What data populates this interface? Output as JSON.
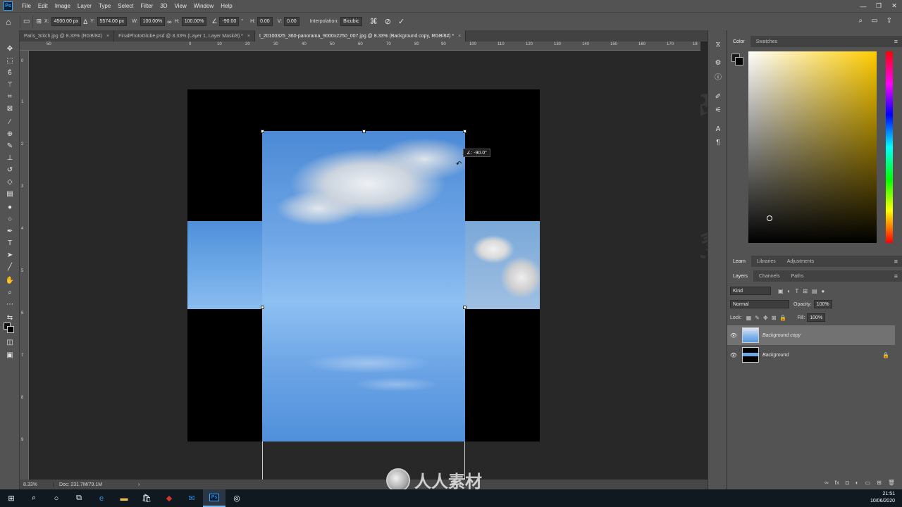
{
  "app": {
    "logo_text": "Ps"
  },
  "menu": [
    "File",
    "Edit",
    "Image",
    "Layer",
    "Type",
    "Select",
    "Filter",
    "3D",
    "View",
    "Window",
    "Help"
  ],
  "window_controls": [
    "—",
    "❐",
    "✕"
  ],
  "options_bar": {
    "x_label": "X:",
    "x_value": "4500.00 px",
    "y_label": "Y:",
    "y_value": "5574.00 px",
    "w_label": "W:",
    "w_value": "100.00%",
    "h_label": "H:",
    "h_value": "100.00%",
    "angle_value": "-90.00",
    "angle_unit": "°",
    "hskew_label": "H:",
    "hskew_value": "0.00",
    "vskew_label": "V:",
    "vskew_value": "0.00",
    "interpolation_label": "Interpolation:",
    "interpolation_value": "Bicubic"
  },
  "tabs": [
    {
      "label": "Paris_Stitch.jpg @ 8.33% (RGB/8#)",
      "close": "×"
    },
    {
      "label": "FinalPhotoGlobe.psd @ 8.33% (Layer 1, Layer Mask/8) *",
      "close": "×"
    },
    {
      "label": "t_20100325_360-panorama_9000x2250_007.jpg @ 8.33% (Background copy, RGB/8#) *",
      "close": "×"
    }
  ],
  "ruler_top_labels": [
    "50",
    "0",
    "10",
    "20",
    "30",
    "40",
    "50",
    "60",
    "70",
    "80",
    "90",
    "100",
    "110",
    "120",
    "130",
    "140",
    "150",
    "160",
    "170",
    "18"
  ],
  "ruler_left_labels": [
    "0",
    "1",
    "2",
    "3",
    "4",
    "5",
    "6",
    "7",
    "8",
    "9"
  ],
  "transform": {
    "angle_tooltip": "∠: -90.0°"
  },
  "color_panel": {
    "tabs": [
      "Color",
      "Swatches"
    ]
  },
  "learn_panel": {
    "tabs": [
      "Learn",
      "Libraries",
      "Adjustments"
    ]
  },
  "layers_panel": {
    "tabs": [
      "Layers",
      "Channels",
      "Paths"
    ],
    "kind_placeholder": "Kind",
    "blend_mode": "Normal",
    "opacity_label": "Opacity:",
    "opacity_value": "100%",
    "lock_label": "Lock:",
    "fill_label": "Fill:",
    "fill_value": "100%",
    "layers": [
      {
        "name": "Background copy",
        "selected": true
      },
      {
        "name": "Background",
        "selected": false,
        "locked": true
      }
    ]
  },
  "status": {
    "zoom": "8.33%",
    "doc": "Doc: 231.7M/79.1M",
    "arrow": "›"
  },
  "taskbar": {
    "time": "21:51",
    "date": "10/06/2020"
  },
  "watermark": {
    "bottom_text": "人人素材",
    "tiles": [
      "RRCG",
      "人人素材"
    ]
  }
}
